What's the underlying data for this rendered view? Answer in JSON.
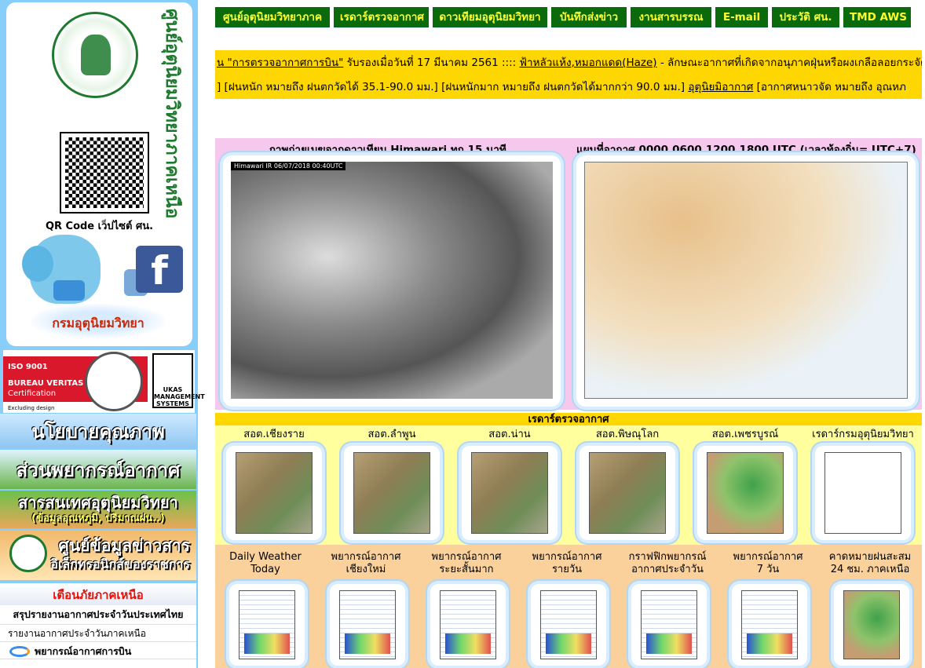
{
  "sidebar": {
    "org_name_vertical": "ศูนย์อุตุนิยมวิทยาภาคเหนือ",
    "qr_label": "QR Code เว็ปไซต์ ศน.",
    "facebook_glyph": "f",
    "dept_logo_text": "กรมอุตุนิยมวิทยา",
    "iso": {
      "line1": "ISO 9001",
      "line2": "BUREAU VERITAS",
      "line3": "Certification",
      "excluding": "Excluding design",
      "ukas": "UKAS MANAGEMENT SYSTEMS"
    },
    "banners": {
      "quality_policy": "นโยบายคุณภาพ",
      "forecast_division": "ส่วนพยากรณ์อากาศ",
      "met_info": "สารสนเทศอุตุนิยมวิทยา",
      "met_info_sub": "(ข้อมูลอุณหภูมิ, ปริมาณฝน..)",
      "egov_line1": "ศูนย์ข้อมูลข่าวสาร",
      "egov_line2": "อิเล็กทรอนิกส์ของราชการ"
    },
    "links": {
      "warning": "เตือนภัยภาคเหนือ",
      "thailand_summary": "สรุปรายงานอากาศประจำวันประเทศไทย",
      "north_report": "รายงานอากาศประจำวันภาคเหนือ",
      "aviation": "พยากรณ์อากาศการบิน"
    }
  },
  "nav": [
    "ศูนย์อุตุนิยมวิทยาภาค",
    "เรดาร์ตรวจอากาศ",
    "ดาวเทียมอุตุนิยมวิทยา",
    "บันทึกส่งข่าว",
    "งานสารบรรณ",
    "E-mail",
    "ประวัติ ศน.",
    "TMD AWS"
  ],
  "ticker": {
    "line1_prefix": "น ",
    "line1_link1": "\"การตรวจอากาศการบิน\"",
    "line1_mid": " รับรองเมื่อวันที่ 17 มีนาคม 2561 :::: ",
    "line1_link2": "ฟ้าหลัวแห้ง,หมอกแดด(Haze)",
    "line1_tail": " - ลักษณะอากาศที่เกิดจากอนุภาคฝุ่นหรือผงเกลือลอยกระจัดกร",
    "line2_part1": "]   [ฝนหนัก หมายถึง ฝนตกวัดได้ 35.1-90.0 มม.]   [ฝนหนักมาก หมายถึง ฝนตกวัดได้มากกว่า 90.0 มม.]   ",
    "line2_link": "อุตุนิยมิอากาศ",
    "line2_tail": "   [อากาศหนาวจัด หมายถึง อุณหภ"
  },
  "satellite": {
    "title": "ภาพถ่ายเมฆจากดาวเทียม Himawari ทุก 15 นาที",
    "image_label": "Himawari IR 06/07/2018 00:40UTC"
  },
  "weather_map": {
    "title": "แผนที่อากาศ 0000,0600,1200,1800 UTC (เวลาท้องถิ่น= UTC+7)"
  },
  "radar": {
    "header": "เรดาร์ตรวจอากาศ",
    "stations": [
      "สอต.เชียงราย",
      "สอต.ลำพูน",
      "สอต.น่าน",
      "สอต.พิษณุโลก",
      "สอต.เพชรบูรณ์",
      "เรดาร์กรมอุตุนิยมวิทยา"
    ]
  },
  "products": [
    {
      "line1": "Daily Weather",
      "line2": "Today"
    },
    {
      "line1": "พยากรณ์อากาศ",
      "line2": "เชียงใหม่"
    },
    {
      "line1": "พยากรณ์อากาศ",
      "line2": "ระยะสั้นมาก"
    },
    {
      "line1": "พยากรณ์อากาศ",
      "line2": "รายวัน"
    },
    {
      "line1": "กราฟฟิกพยากรณ์",
      "line2": "อากาศประจำวัน"
    },
    {
      "line1": "พยากรณ์อากาศ",
      "line2": "7 วัน"
    },
    {
      "line1": "คาดหมายฝนสะสม",
      "line2": "24 ชม. ภาคเหนือ"
    }
  ],
  "colors": {
    "nav_bg": "#0b6a0b",
    "nav_text": "#ffff30",
    "ticker_bg": "#ffd700",
    "sat_panel_bg": "#f6c8ee",
    "radar_panel_bg": "#ffff9e",
    "product_panel_bg": "#fad19a",
    "warning_red": "#e0140b"
  }
}
